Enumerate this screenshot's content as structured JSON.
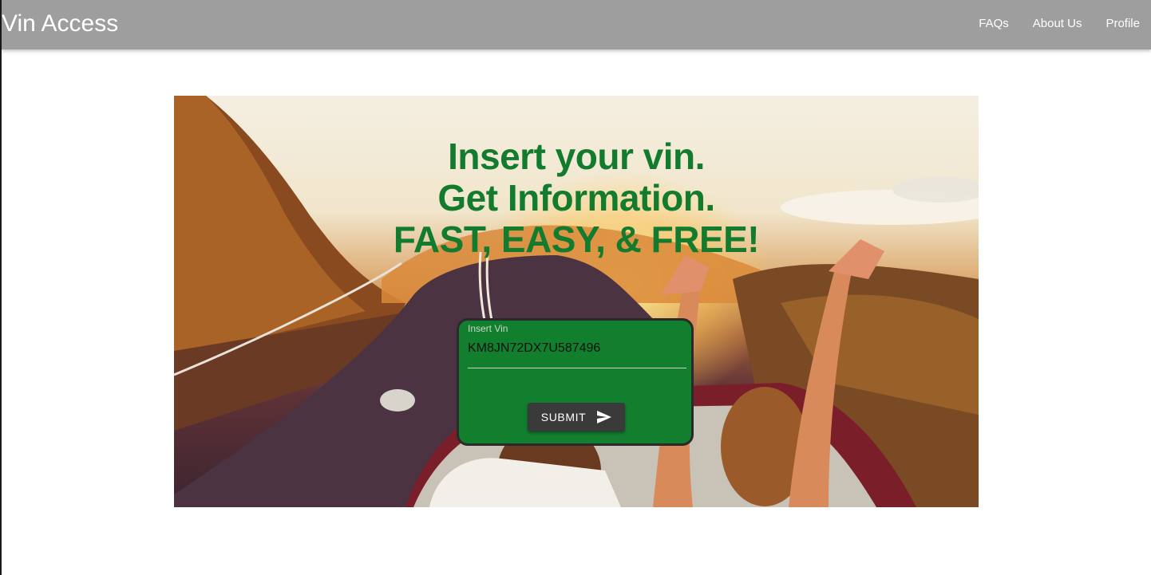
{
  "app": {
    "title": "Vin Access"
  },
  "nav": {
    "items": [
      "FAQs",
      "About Us",
      "Profile"
    ]
  },
  "hero": {
    "line1": "Insert your vin.",
    "line2": "Get Information.",
    "line3": "FAST, EASY, & FREE!"
  },
  "form": {
    "label": "Insert Vin",
    "value": "KM8JN72DX7U587496",
    "submit_label": "SUBMIT",
    "submit_icon": "send-icon"
  },
  "colors": {
    "accent": "#137b2e",
    "card": "#117f2e",
    "appbar": "#9e9e9e",
    "button": "#3a3a3a"
  }
}
